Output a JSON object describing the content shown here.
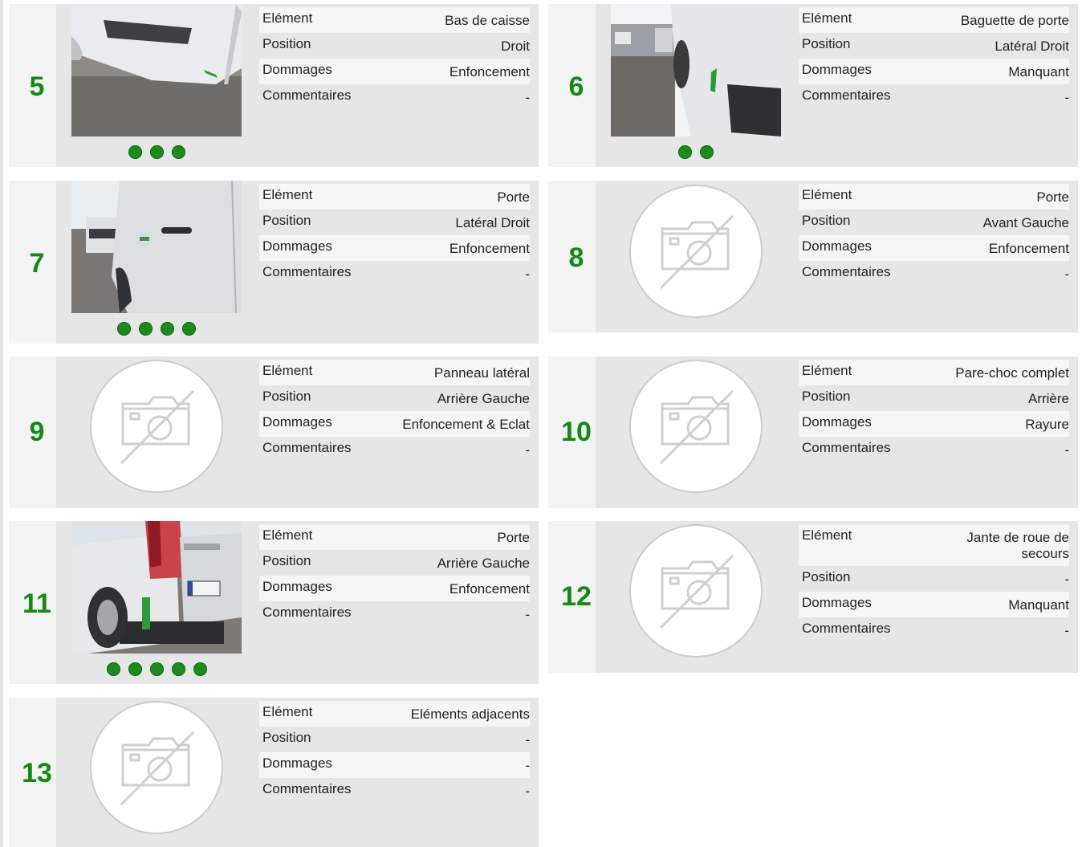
{
  "labels": {
    "element": "Elément",
    "position": "Position",
    "dommages": "Dommages",
    "commentaires": "Commentaires"
  },
  "colors": {
    "number_green": "#148a14",
    "dot_green": "#1e8a1e",
    "card_bg": "#e6e6e6",
    "number_col_bg": "#f3f3f3",
    "row_alt_bg": "#f5f5f5"
  },
  "items": [
    {
      "number": "5",
      "element": "Bas de caisse",
      "position": "Droit",
      "dommages": "Enfoncement",
      "commentaires": "-",
      "photo": "vehicle-photo",
      "photo_count": 3
    },
    {
      "number": "6",
      "element": "Baguette de porte",
      "position": "Latéral Droit",
      "dommages": "Manquant",
      "commentaires": "-",
      "photo": "vehicle-photo",
      "photo_count": 2
    },
    {
      "number": "7",
      "element": "Porte",
      "position": "Latéral Droit",
      "dommages": "Enfoncement",
      "commentaires": "-",
      "photo": "vehicle-photo",
      "photo_count": 4
    },
    {
      "number": "8",
      "element": "Porte",
      "position": "Avant Gauche",
      "dommages": "Enfoncement",
      "commentaires": "-",
      "photo": "no-photo-icon",
      "photo_count": 0
    },
    {
      "number": "9",
      "element": "Panneau latéral",
      "position": "Arrière Gauche",
      "dommages": "Enfoncement & Eclat",
      "commentaires": "-",
      "photo": "no-photo-icon",
      "photo_count": 0
    },
    {
      "number": "10",
      "element": "Pare-choc complet",
      "position": "Arrière",
      "dommages": "Rayure",
      "commentaires": "-",
      "photo": "no-photo-icon",
      "photo_count": 0
    },
    {
      "number": "11",
      "element": "Porte",
      "position": "Arrière Gauche",
      "dommages": "Enfoncement",
      "commentaires": "-",
      "photo": "vehicle-photo",
      "photo_count": 5
    },
    {
      "number": "12",
      "element": "Jante de roue de secours",
      "position": "-",
      "dommages": "Manquant",
      "commentaires": "-",
      "photo": "no-photo-icon",
      "photo_count": 0
    },
    {
      "number": "13",
      "element": "Eléments adjacents",
      "position": "-",
      "dommages": "-",
      "commentaires": "-",
      "photo": "no-photo-icon",
      "photo_count": 0
    }
  ]
}
